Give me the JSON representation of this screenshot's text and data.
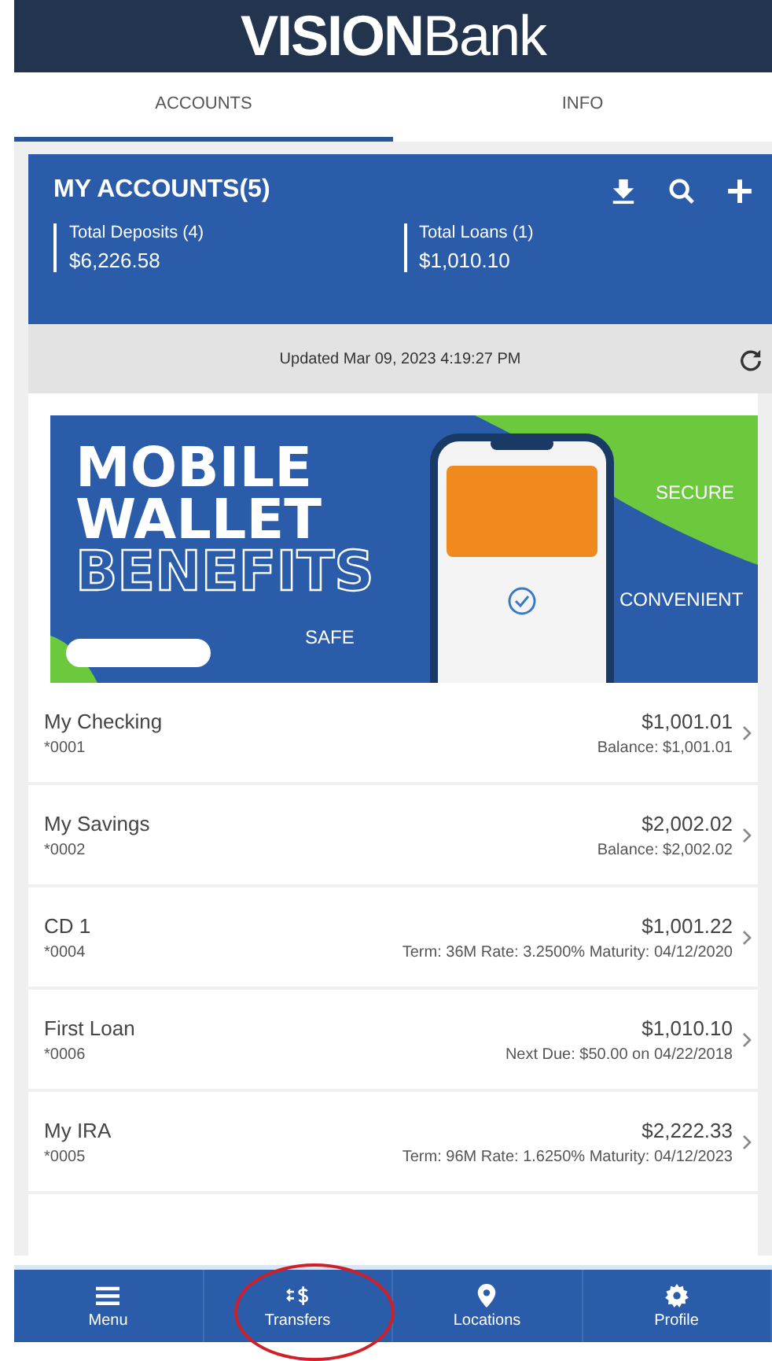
{
  "header": {
    "logo_bold": "VISION",
    "logo_light": "Bank"
  },
  "tabs": [
    {
      "label": "ACCOUNTS",
      "selected": true
    },
    {
      "label": "INFO",
      "selected": false
    }
  ],
  "summary": {
    "title": "MY ACCOUNTS(5)",
    "totals": [
      {
        "label": "Total Deposits (4)",
        "amount": "$6,226.58"
      },
      {
        "label": "Total Loans (1)",
        "amount": "$1,010.10"
      }
    ]
  },
  "updated": "Updated Mar 09, 2023 4:19:27 PM",
  "banner": {
    "lines": [
      "MOBILE",
      "WALLET",
      "BENEFITS"
    ],
    "labels": [
      "SECURE",
      "CONVENIENT",
      "SAFE"
    ]
  },
  "accounts": [
    {
      "name": "My Checking",
      "number": "*0001",
      "amount": "$1,001.01",
      "detail": "Balance: $1,001.01"
    },
    {
      "name": "My Savings",
      "number": "*0002",
      "amount": "$2,002.02",
      "detail": "Balance: $2,002.02"
    },
    {
      "name": "CD 1",
      "number": "*0004",
      "amount": "$1,001.22",
      "detail": "Term: 36M  Rate: 3.2500%  Maturity: 04/12/2020"
    },
    {
      "name": "First Loan",
      "number": "*0006",
      "amount": "$1,010.10",
      "detail": "Next Due: $50.00 on 04/22/2018"
    },
    {
      "name": "My IRA",
      "number": "*0005",
      "amount": "$2,222.33",
      "detail": "Term: 96M  Rate: 1.6250%  Maturity: 04/12/2023"
    }
  ],
  "nav": [
    {
      "kind": "menu",
      "label": "Menu",
      "circled": false
    },
    {
      "kind": "transfers",
      "label": "Transfers",
      "circled": true
    },
    {
      "kind": "locations",
      "label": "Locations",
      "circled": false
    },
    {
      "kind": "profile",
      "label": "Profile",
      "circled": false
    }
  ]
}
